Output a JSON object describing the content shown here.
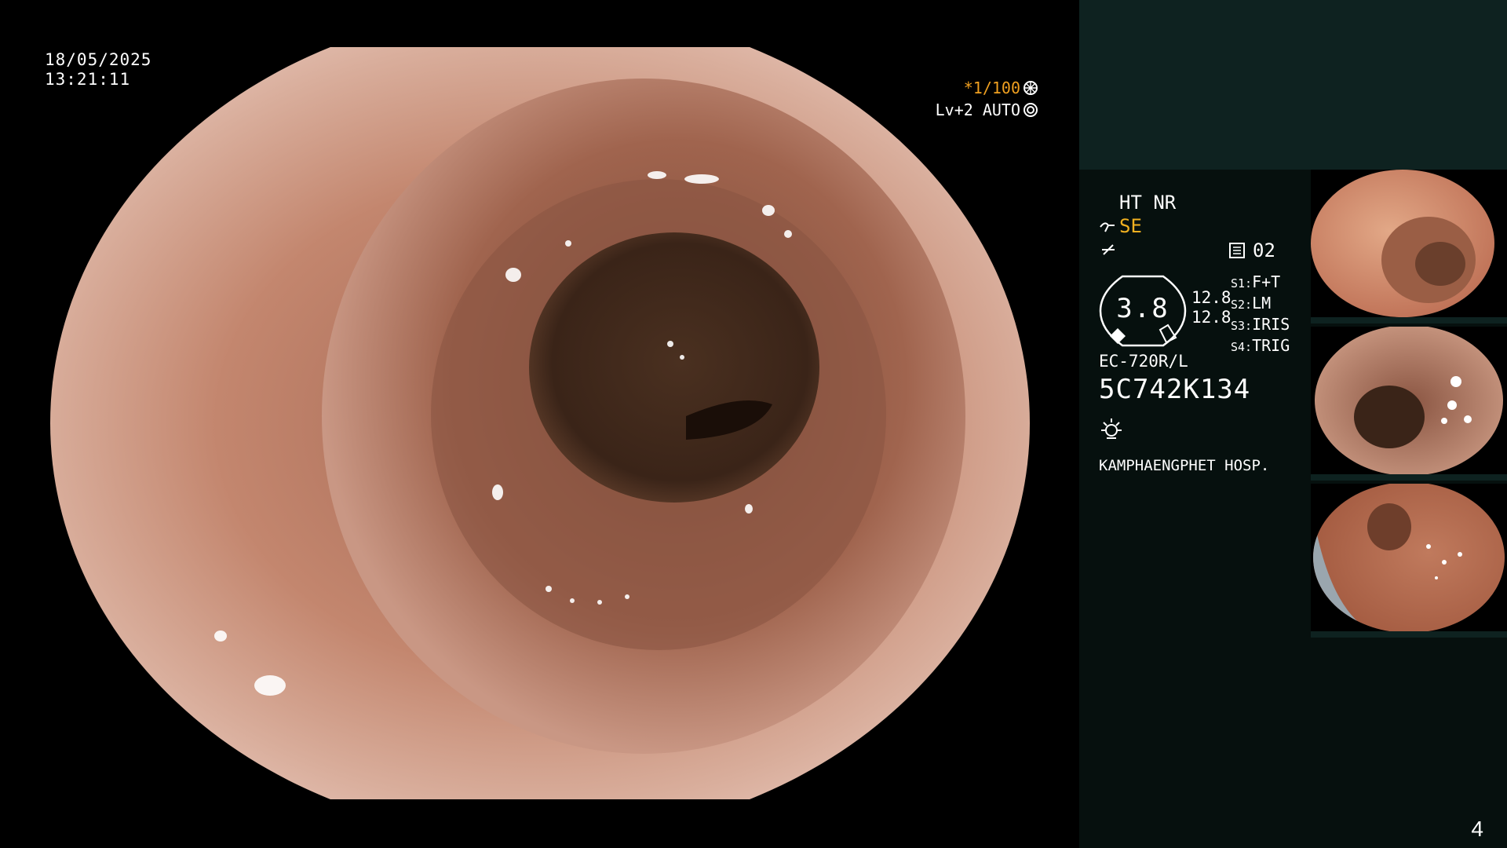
{
  "overlay": {
    "date": "18/05/2025",
    "time": "13:21:11",
    "shutter": "*1/100",
    "level": "Lv+2 AUTO",
    "shutter_icon": "shutter-icon",
    "iris_icon": "iris-icon"
  },
  "panel": {
    "modes": "HT NR",
    "se_label": "SE",
    "memory_value": "02",
    "scope_meter_value": "3.8",
    "readings": [
      "12.8",
      "12.8"
    ],
    "settings": [
      {
        "key": "S1:",
        "value": "F+T"
      },
      {
        "key": "S2:",
        "value": "LM"
      },
      {
        "key": "S3:",
        "value": "IRIS"
      },
      {
        "key": "S4:",
        "value": "TRIG"
      }
    ],
    "scope_model": "EC-720R/L",
    "scope_serial": "5C742K134",
    "hospital": "KAMPHAENGPHET HOSP."
  },
  "thumbnails": [
    {
      "index": 1
    },
    {
      "index": 2
    },
    {
      "index": 3
    }
  ],
  "page_number": "4",
  "colors": {
    "overlay_accent": "#f0a020",
    "panel_bg": "#06100e",
    "panel_header_bg": "#0e2220",
    "mucosa": "#c98f78",
    "lumen": "#3e271a"
  }
}
